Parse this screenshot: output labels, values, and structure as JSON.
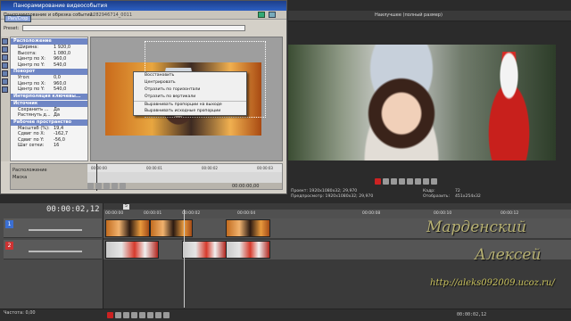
{
  "dialog": {
    "title": "Панорамирование видеособытия",
    "event_label": "Панорамирование и обрезка событий:",
    "event_id": "1282946714_0011",
    "tab": "Pan/Crop",
    "preset_label": "Preset:",
    "sections": [
      {
        "name": "Расположение",
        "rows": [
          {
            "k": "Ширина:",
            "v": "1 920,0"
          },
          {
            "k": "Высота:",
            "v": "1 080,0"
          },
          {
            "k": "Центр по X:",
            "v": "960,0"
          },
          {
            "k": "Центр по Y:",
            "v": "540,0"
          }
        ]
      },
      {
        "name": "Поворот",
        "rows": [
          {
            "k": "Угол:",
            "v": "0,0"
          },
          {
            "k": "Центр по X:",
            "v": "960,0"
          },
          {
            "k": "Центр по Y:",
            "v": "540,0"
          }
        ]
      },
      {
        "name": "Интерполяция ключевы...",
        "rows": []
      },
      {
        "name": "Источник",
        "rows": [
          {
            "k": "Сохранить ...",
            "v": "Да"
          },
          {
            "k": "Растянуть д...",
            "v": "Да"
          }
        ]
      },
      {
        "name": "Рабочее пространство",
        "rows": [
          {
            "k": "Масштаб (%):",
            "v": "19,4"
          },
          {
            "k": "Сдвиг по X:",
            "v": "-162,7"
          },
          {
            "k": "Сдвиг по Y:",
            "v": "-56,0"
          },
          {
            "k": "Шаг сетки:",
            "v": "16"
          }
        ]
      }
    ],
    "context_menu": [
      "Восстановить",
      "Центрировать",
      "Отразить по горизонтали",
      "Отразить по вертикали",
      "Выравнивать пропорции на выходе",
      "Выравнивать исходные пропорции"
    ],
    "timeline": {
      "label_position": "Расположение",
      "label_mask": "Маска",
      "ticks": [
        "00:00:00",
        "00:00:01",
        "00:00:02",
        "00:00:03"
      ],
      "bottom_tc": "00:00:00,00"
    }
  },
  "preview": {
    "mode": "Наилучшее (полный размер)",
    "project_label": "Проект:",
    "project_value": "1920x1080x32; 29,970",
    "preview_label": "Предпросмотр:",
    "preview_value": "1920x1080x32; 29,970",
    "frame_label": "Кадр:",
    "frame_value": "72",
    "display_label": "Отобразить:",
    "display_value": "451x254x32"
  },
  "timeline": {
    "timecode": "00:00:02,12",
    "ruler": [
      "00:00:00",
      "00:00:01",
      "00:00:02",
      "00:00:04",
      "00:00:08",
      "00:00:10",
      "00:00:12"
    ],
    "marker": "5",
    "tracks": [
      {
        "num": "1"
      },
      {
        "num": "2"
      }
    ],
    "rate_label": "Частота: 0,00",
    "bottom_tc": "00:00:02,12"
  },
  "watermark": {
    "line1": "Марденский",
    "line2": "Алексей",
    "url": "http://aleks092009.ucoz.ru/"
  },
  "colors": {
    "accent": "#3b6fd2",
    "track2": "#cc3333",
    "title_bar": "#2c5fc2"
  },
  "icons": [
    "close-icon",
    "record-icon",
    "play-icon",
    "stop-icon",
    "loop-icon",
    "prev-frame-icon",
    "next-frame-icon"
  ]
}
